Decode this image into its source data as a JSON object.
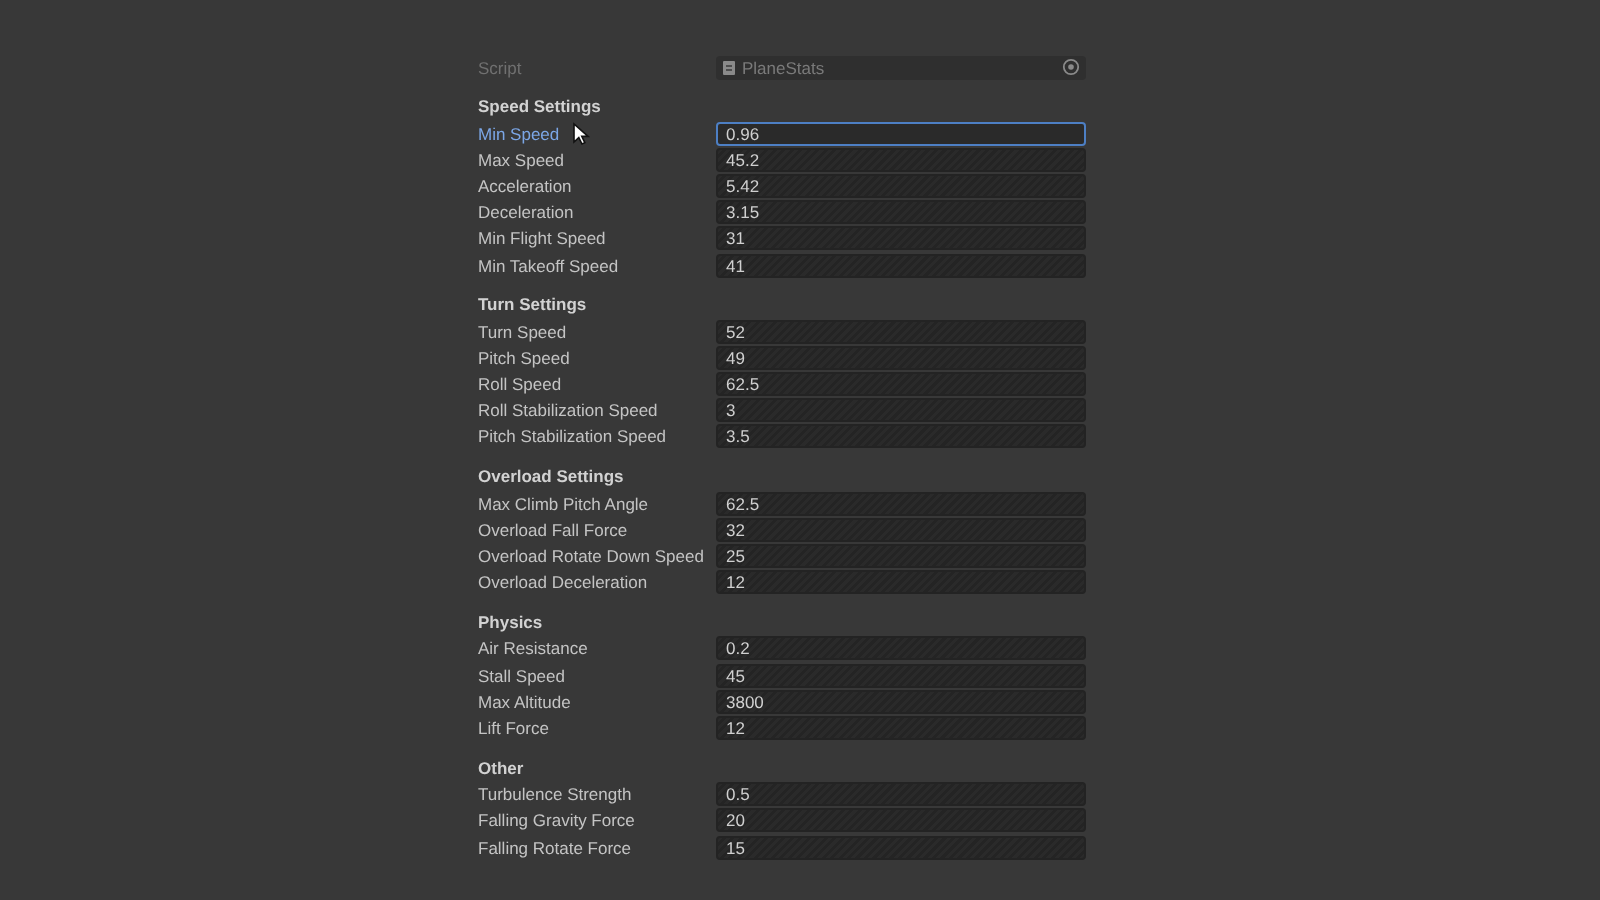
{
  "script_field": {
    "label": "Script",
    "value": "PlaneStats",
    "disabled": true
  },
  "sections": [
    {
      "header": "Speed Settings",
      "fields": [
        {
          "label": "Min Speed",
          "value": "0.96",
          "focused": true
        },
        {
          "label": "Max Speed",
          "value": "45.2",
          "focused": false
        },
        {
          "label": "Acceleration",
          "value": "5.42",
          "focused": false
        },
        {
          "label": "Deceleration",
          "value": "3.15",
          "focused": false
        },
        {
          "label": "Min Flight Speed",
          "value": "31",
          "focused": false
        },
        {
          "label": "Min Takeoff Speed",
          "value": "41",
          "focused": false
        }
      ]
    },
    {
      "header": "Turn Settings",
      "fields": [
        {
          "label": "Turn Speed",
          "value": "52",
          "focused": false
        },
        {
          "label": "Pitch Speed",
          "value": "49",
          "focused": false
        },
        {
          "label": "Roll Speed",
          "value": "62.5",
          "focused": false
        },
        {
          "label": "Roll Stabilization Speed",
          "value": "3",
          "focused": false
        },
        {
          "label": "Pitch Stabilization Speed",
          "value": "3.5",
          "focused": false
        }
      ]
    },
    {
      "header": "Overload Settings",
      "fields": [
        {
          "label": "Max Climb Pitch Angle",
          "value": "62.5",
          "focused": false
        },
        {
          "label": "Overload Fall Force",
          "value": "32",
          "focused": false
        },
        {
          "label": "Overload Rotate Down Speed",
          "value": "25",
          "focused": false
        },
        {
          "label": "Overload Deceleration",
          "value": "12",
          "focused": false
        }
      ]
    },
    {
      "header": "Physics",
      "fields": [
        {
          "label": "Air Resistance",
          "value": "0.2",
          "focused": false
        },
        {
          "label": "Stall Speed",
          "value": "45",
          "focused": false
        },
        {
          "label": "Max Altitude",
          "value": "3800",
          "focused": false
        },
        {
          "label": "Lift Force",
          "value": "12",
          "focused": false
        }
      ]
    },
    {
      "header": "Other",
      "fields": [
        {
          "label": "Turbulence Strength",
          "value": "0.5",
          "focused": false
        },
        {
          "label": "Falling Gravity Force",
          "value": "20",
          "focused": false
        },
        {
          "label": "Falling Rotate Force",
          "value": "15",
          "focused": false
        }
      ]
    }
  ]
}
